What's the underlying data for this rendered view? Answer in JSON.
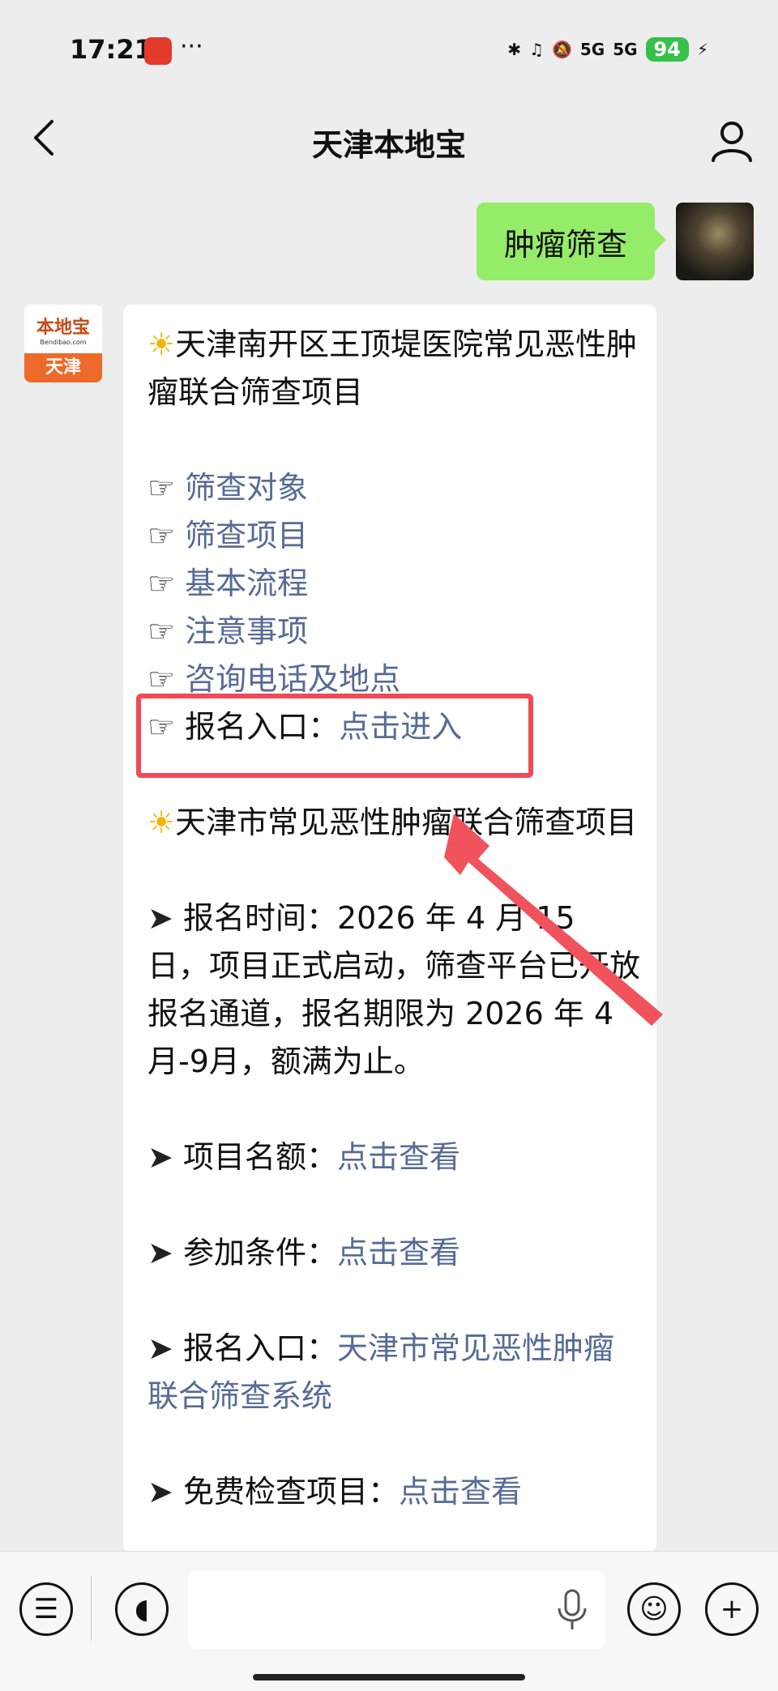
{
  "status": {
    "time": "17:21",
    "dots": "···",
    "signal1": "5G",
    "signal2": "5G",
    "battery": "94"
  },
  "nav": {
    "title": "天津本地宝"
  },
  "chat": {
    "out_message": "肿瘤筛查",
    "bot_avatar_top": "本地宝",
    "bot_avatar_sub": "Bendibao.com",
    "bot_avatar_city": "天津",
    "section1_title": "天津南开区王顶堤医院常见恶性肿瘤联合筛查项目",
    "links": [
      "筛查对象",
      "筛查项目",
      "基本流程",
      "注意事项",
      "咨询电话及地点"
    ],
    "reg1_label": "报名入口：",
    "reg1_link": "点击进入",
    "section2_title": "天津市常见恶性肿瘤联合筛查项目",
    "time_label": "报名时间：",
    "time_text": "2026 年 4 月 15 日，项目正式启动，筛查平台已开放报名通道，报名期限为 2026 年 4 月-9月，额满为止。",
    "quota_label": "项目名额：",
    "quota_link": "点击查看",
    "cond_label": "参加条件：",
    "cond_link": "点击查看",
    "reg2_label": "报名入口：",
    "reg2_link": "天津市常见恶性肿瘤联合筛查系统",
    "free_label": "免费检查项目：",
    "free_link": "点击查看"
  },
  "colors": {
    "link": "#576b95",
    "highlight_box": "#f04a55",
    "out_bubble": "#95ec69",
    "battery": "#36c24a"
  },
  "icons": [
    "back-arrow-icon",
    "profile-icon",
    "sun-icon",
    "pointing-hand-icon",
    "arrow-bullet-icon",
    "list-menu-icon",
    "voice-icon",
    "mic-icon",
    "emoji-icon",
    "plus-icon"
  ]
}
